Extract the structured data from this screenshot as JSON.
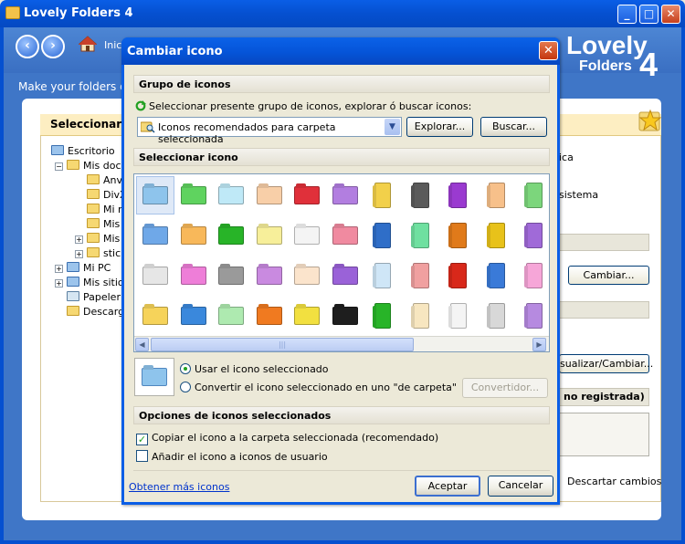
{
  "main_window": {
    "title": "Lovely Folders 4",
    "nav_home_label": "Inic",
    "tagline": "Make your folders dif",
    "logo_top": "Lovely",
    "logo_bottom": "Folders",
    "logo_number": "4",
    "window_buttons": {
      "minimize": "_",
      "maximize": "□",
      "close": "✕"
    }
  },
  "background_panel": {
    "header": "Seleccionar d",
    "tree": [
      {
        "label": "Escritorio",
        "depth": 0,
        "expander": "",
        "icon": "desktop-icon"
      },
      {
        "label": "Mis doc",
        "depth": 1,
        "expander": "−",
        "icon": "documents-icon"
      },
      {
        "label": "Anv",
        "depth": 2,
        "expander": "",
        "icon": "folder-icon"
      },
      {
        "label": "DivX",
        "depth": 2,
        "expander": "",
        "icon": "folder-icon"
      },
      {
        "label": "Mi m",
        "depth": 2,
        "expander": "",
        "icon": "music-folder-icon"
      },
      {
        "label": "Mis",
        "depth": 2,
        "expander": "",
        "icon": "pictures-folder-icon"
      },
      {
        "label": "Mis",
        "depth": 2,
        "expander": "+",
        "icon": "videos-folder-icon"
      },
      {
        "label": "stic",
        "depth": 2,
        "expander": "+",
        "icon": "folder-icon"
      },
      {
        "label": "Mi PC",
        "depth": 1,
        "expander": "+",
        "icon": "computer-icon"
      },
      {
        "label": "Mis sitio",
        "depth": 1,
        "expander": "+",
        "icon": "network-icon"
      },
      {
        "label": "Papeler",
        "depth": 1,
        "expander": "",
        "icon": "recycle-bin-icon"
      },
      {
        "label": "Descarg",
        "depth": 1,
        "expander": "",
        "icon": "folder-icon"
      }
    ],
    "right_text_1": "ica",
    "right_text_2": "sistema",
    "cambiar_button": "Cambiar...",
    "visualizar_button": "sualizar/Cambiar...",
    "registration_label": "no registrada)",
    "discard_label": "Descartar cambios"
  },
  "dialog": {
    "title": "Cambiar icono",
    "close": "✕",
    "group_section": {
      "heading": "Grupo de iconos",
      "instruction": "Seleccionar presente grupo de iconos, explorar ó buscar iconos:",
      "combo_value": "Iconos recomendados para carpeta seleccionada",
      "combo_arrow": "▼",
      "explore_button": "Explorar...",
      "search_button": "Buscar..."
    },
    "select_section": {
      "heading": "Seleccionar icono",
      "scroll_left": "◀",
      "scroll_right": "▶",
      "scroll_grip": "|||",
      "icons": [
        {
          "color": "#8ec4ec",
          "shape": "folder-icon",
          "selected": true
        },
        {
          "color": "#5fd35f",
          "shape": "folder-icon"
        },
        {
          "color": "#bfe9f7",
          "shape": "folder-icon"
        },
        {
          "color": "#f8cfa8",
          "shape": "folder-icon"
        },
        {
          "color": "#e0303a",
          "shape": "folder-icon"
        },
        {
          "color": "#b27ee0",
          "shape": "folder-icon"
        },
        {
          "color": "#f2d04a",
          "shape": "vertical-folder-icon"
        },
        {
          "color": "#5a5a5a",
          "shape": "vertical-folder-icon"
        },
        {
          "color": "#9a3ad0",
          "shape": "vertical-folder-icon"
        },
        {
          "color": "#f7c08a",
          "shape": "vertical-folder-icon"
        },
        {
          "color": "#7cd67c",
          "shape": "vertical-folder-icon"
        },
        {
          "color": "#6fa8e8",
          "shape": "folder-icon"
        },
        {
          "color": "#f8b85a",
          "shape": "folder-icon"
        },
        {
          "color": "#28b428",
          "shape": "folder-icon"
        },
        {
          "color": "#f7ef9a",
          "shape": "folder-icon"
        },
        {
          "color": "#f4f4f4",
          "shape": "folder-icon"
        },
        {
          "color": "#f08aa0",
          "shape": "folder-icon"
        },
        {
          "color": "#2f6ec8",
          "shape": "vertical-folder-icon"
        },
        {
          "color": "#6fe0a0",
          "shape": "vertical-folder-icon"
        },
        {
          "color": "#e07a1a",
          "shape": "vertical-folder-icon"
        },
        {
          "color": "#e8c21a",
          "shape": "vertical-folder-icon"
        },
        {
          "color": "#a06ad8",
          "shape": "vertical-folder-icon"
        },
        {
          "color": "#e6e6e6",
          "shape": "folder-icon"
        },
        {
          "color": "#ee7ed8",
          "shape": "folder-icon"
        },
        {
          "color": "#9a9a9a",
          "shape": "folder-icon"
        },
        {
          "color": "#c98ae0",
          "shape": "folder-icon"
        },
        {
          "color": "#fbe4cc",
          "shape": "folder-icon"
        },
        {
          "color": "#9a62d8",
          "shape": "folder-icon"
        },
        {
          "color": "#cfe6f7",
          "shape": "vertical-folder-icon"
        },
        {
          "color": "#f0a0a0",
          "shape": "vertical-folder-icon"
        },
        {
          "color": "#d8281a",
          "shape": "vertical-folder-icon"
        },
        {
          "color": "#3a7ad8",
          "shape": "vertical-folder-icon"
        },
        {
          "color": "#f6a6d8",
          "shape": "vertical-folder-icon"
        },
        {
          "color": "#f6d35a",
          "shape": "folder-icon"
        },
        {
          "color": "#3a88dc",
          "shape": "folder-icon"
        },
        {
          "color": "#aeeab0",
          "shape": "folder-icon"
        },
        {
          "color": "#f07a20",
          "shape": "folder-icon"
        },
        {
          "color": "#f2e040",
          "shape": "folder-icon"
        },
        {
          "color": "#1e1e1e",
          "shape": "folder-icon"
        },
        {
          "color": "#28b428",
          "shape": "vertical-folder-icon"
        },
        {
          "color": "#f7e6c0",
          "shape": "vertical-folder-icon"
        },
        {
          "color": "#f4f4f4",
          "shape": "vertical-folder-icon"
        },
        {
          "color": "#d8d8d8",
          "shape": "vertical-folder-icon"
        },
        {
          "color": "#b68ae0",
          "shape": "vertical-folder-icon"
        }
      ]
    },
    "use_selected_label": "Usar el icono seleccionado",
    "convert_label": "Convertir el icono seleccionado en uno \"de carpeta\"",
    "converter_button": "Convertidor...",
    "options_section": {
      "heading": "Opciones de iconos seleccionados",
      "copy_option": "Copiar el icono a la carpeta seleccionada (recomendado)",
      "copy_checked": true,
      "add_option": "Añadir el icono a iconos de usuario",
      "add_checked": false,
      "check_mark": "✓"
    },
    "more_icons_link": "Obtener más iconos",
    "accept_button": "Aceptar",
    "cancel_button": "Cancelar"
  }
}
